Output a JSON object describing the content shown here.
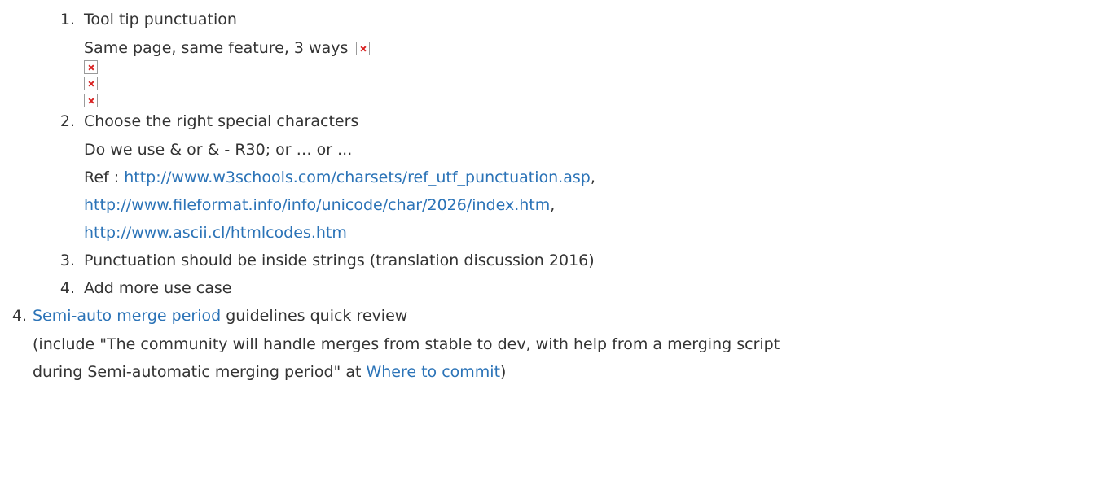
{
  "outer_list": {
    "current_item": {
      "number": "4.",
      "link_text": "Semi-auto merge period",
      "text_after_link": " guidelines quick review",
      "note_line1": "(include \"The community will handle merges from stable to dev, with help from a merging script",
      "note_line2_prefix": "during Semi-automatic merging period\" at ",
      "note_link_text": "Where to commit",
      "note_line2_suffix": ")"
    }
  },
  "inner_list": {
    "item1": {
      "number": "1.",
      "title": "Tool tip punctuation",
      "subtitle": "Same page, same feature, 3 ways"
    },
    "item2": {
      "number": "2.",
      "title": "Choose the right special characters",
      "question": "Do we use & or & - R30; or … or ...",
      "ref_label": "Ref : ",
      "ref_links": [
        "http://www.w3schools.com/charsets/ref_utf_punctuation.asp",
        "http://www.fileformat.info/info/unicode/char/2026/index.htm",
        "http://www.ascii.cl/htmlcodes.htm"
      ],
      "separator": ","
    },
    "item3": {
      "number": "3.",
      "title": "Punctuation should be inside strings (translation discussion 2016)"
    },
    "item4": {
      "number": "4.",
      "title": "Add more use case"
    }
  }
}
